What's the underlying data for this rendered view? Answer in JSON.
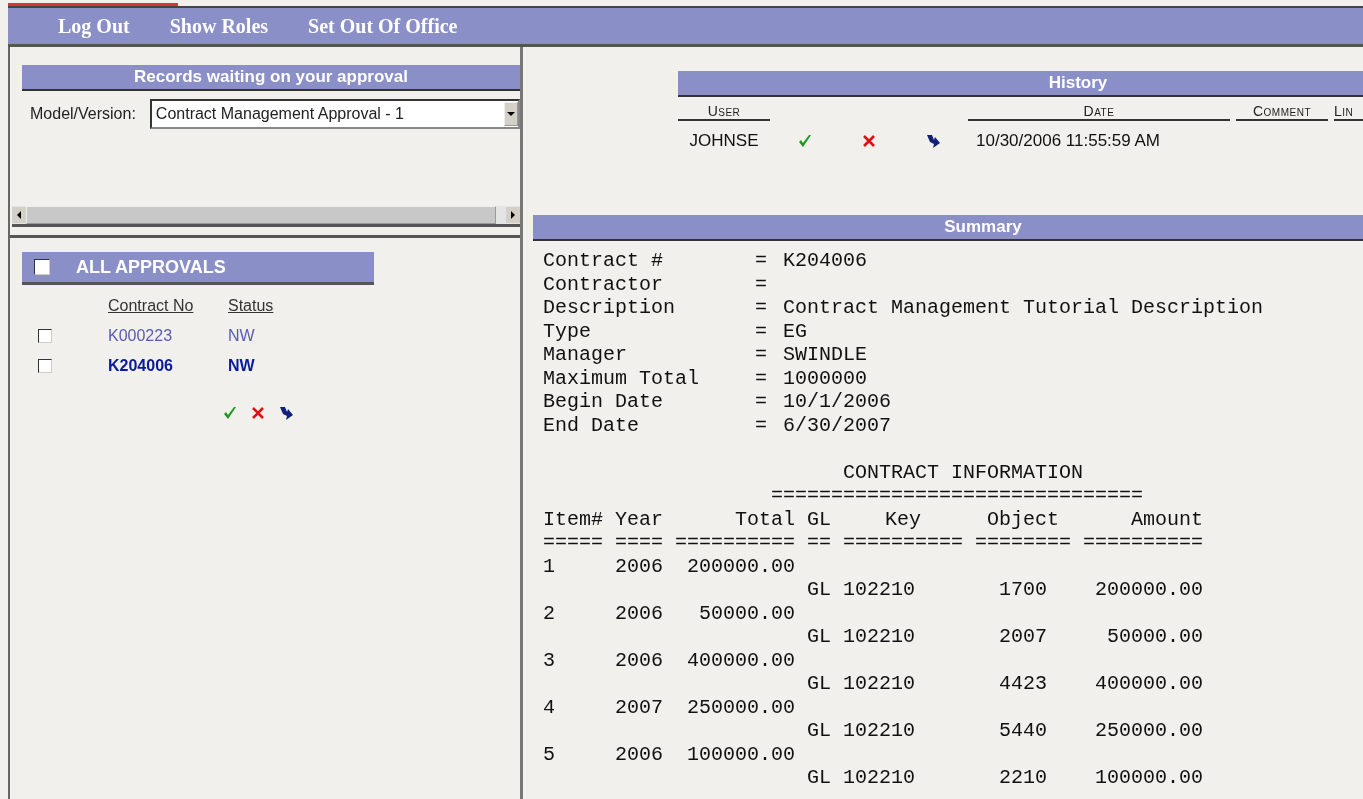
{
  "menu": [
    {
      "label": "Log Out"
    },
    {
      "label": "Show Roles"
    },
    {
      "label": "Set Out Of Office"
    }
  ],
  "approvals_header": {
    "title": "Records waiting on your approval"
  },
  "model_version": {
    "label": "Model/Version:",
    "value": "Contract Management Approval - 1"
  },
  "approvals": {
    "title": "ALL APPROVALS",
    "checked": false,
    "columns": [
      "Contract No",
      "Status"
    ],
    "rows": [
      {
        "contract_no": "K000223",
        "status": "NW",
        "checked": false,
        "selected": false
      },
      {
        "contract_no": "K204006",
        "status": "NW",
        "checked": false,
        "selected": true
      }
    ]
  },
  "history": {
    "title": "History",
    "columns": [
      "User",
      "Date",
      "Comment",
      "Lin"
    ],
    "rows": [
      {
        "user": "JOHNSE",
        "date": "10/30/2006 11:55:59 AM"
      }
    ]
  },
  "summary": {
    "title": "Summary",
    "fields": [
      {
        "label": "Contract #",
        "value": "K204006"
      },
      {
        "label": "Contractor"
      },
      {
        "label": "Description",
        "value": "Contract Management Tutorial Description"
      },
      {
        "label": "Type",
        "value": "EG"
      },
      {
        "label": "Manager",
        "value": "SWINDLE"
      },
      {
        "label": "Maximum Total",
        "value": "1000000"
      },
      {
        "label": "Begin Date",
        "value": "10/1/2006"
      },
      {
        "label": "End Date",
        "value": "6/30/2007"
      }
    ],
    "separator": "=",
    "section_title": "CONTRACT INFORMATION",
    "section_rule": "===============================",
    "columns": [
      "Item#",
      "Year",
      "Total",
      "GL",
      "Key",
      "Object",
      "Amount"
    ],
    "column_rules": [
      "=====",
      "====",
      "==========",
      "==",
      "==========",
      "========",
      "=========="
    ],
    "items": [
      {
        "item": "1",
        "year": "2006",
        "total": "200000.00",
        "gl": "GL",
        "key": "102210",
        "object": "1700",
        "amount": "200000.00"
      },
      {
        "item": "2",
        "year": "2006",
        "total": "50000.00",
        "gl": "GL",
        "key": "102210",
        "object": "2007",
        "amount": "50000.00"
      },
      {
        "item": "3",
        "year": "2006",
        "total": "400000.00",
        "gl": "GL",
        "key": "102210",
        "object": "4423",
        "amount": "400000.00"
      },
      {
        "item": "4",
        "year": "2007",
        "total": "250000.00",
        "gl": "GL",
        "key": "102210",
        "object": "5440",
        "amount": "250000.00"
      },
      {
        "item": "5",
        "year": "2006",
        "total": "100000.00",
        "gl": "GL",
        "key": "102210",
        "object": "2210",
        "amount": "100000.00"
      }
    ]
  }
}
